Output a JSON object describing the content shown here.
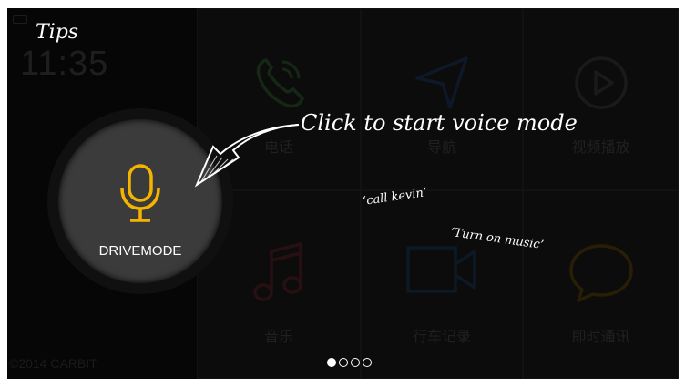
{
  "tips_title": "Tips",
  "clock": "11:35",
  "copyright": "©2014 CARBIT",
  "apps": [
    {
      "label": "电话",
      "icon": "phone-icon"
    },
    {
      "label": "导航",
      "icon": "navigation-icon"
    },
    {
      "label": "视频播放",
      "icon": "video-play-icon"
    },
    {
      "label": "音乐",
      "icon": "music-icon"
    },
    {
      "label": "行车记录",
      "icon": "dashcam-icon"
    },
    {
      "label": "即时通讯",
      "icon": "chat-icon"
    }
  ],
  "drive_mode": {
    "label": "DRIVEMODE",
    "icon": "microphone-icon"
  },
  "hints": {
    "main": "Click to start voice mode",
    "example_1": "‘call kevin’",
    "example_2": "‘Turn on music’"
  },
  "pager": {
    "total": 4,
    "current": 1
  },
  "colors": {
    "accent": "#f5b400",
    "background": "#0a0a0a",
    "hint_text": "#ffffff"
  }
}
